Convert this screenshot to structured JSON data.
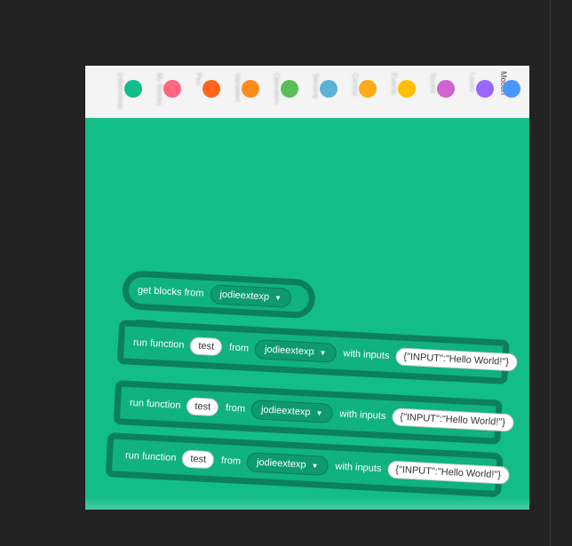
{
  "palette": {
    "categories": [
      {
        "label": "Motion",
        "color": "#4c97ff"
      },
      {
        "label": "Looks",
        "color": "#9966ff"
      },
      {
        "label": "Sound",
        "color": "#cf63cf"
      },
      {
        "label": "Events",
        "color": "#ffbf00"
      },
      {
        "label": "Control",
        "color": "#ffab19"
      },
      {
        "label": "Sensing",
        "color": "#5cb1d6"
      },
      {
        "label": "Operators",
        "color": "#59c059"
      },
      {
        "label": "Variables",
        "color": "#ff8c1a"
      },
      {
        "label": "My Blocks",
        "color": "#ff6680"
      },
      {
        "label": "Pen",
        "color": "#ff661a"
      },
      {
        "label": "jodieextexp",
        "color": "#0fbd8c"
      }
    ]
  },
  "blocks": [
    {
      "text": "get blocks from",
      "menu": "jodieextexp"
    },
    {
      "prefix": "run function",
      "func": "test",
      "from": "from",
      "menu": "jodieextexp",
      "with": "with inputs",
      "inputs": "{\"INPUT\":\"Hello World!\"}"
    },
    {
      "prefix": "run function",
      "func": "test",
      "from": "from",
      "menu": "jodieextexp",
      "with": "with inputs",
      "inputs": "{\"INPUT\":\"Hello World!\"}"
    },
    {
      "prefix": "run function",
      "func": "test",
      "from": "from",
      "menu": "jodieextexp",
      "with": "with inputs",
      "inputs": "{\"INPUT\":\"Hello World!\"}"
    }
  ]
}
